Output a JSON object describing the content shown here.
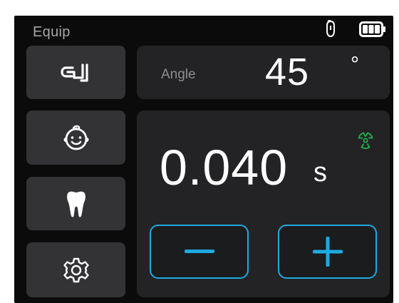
{
  "header": {
    "title": "Equip"
  },
  "status": {
    "probe_icon": "probe-icon",
    "battery_icon": "battery-icon",
    "battery_level": "full"
  },
  "sidebar": {
    "items": [
      {
        "icon": "tube-head-icon"
      },
      {
        "icon": "child-face-icon"
      },
      {
        "icon": "tooth-icon"
      },
      {
        "icon": "gear-icon"
      }
    ]
  },
  "angle": {
    "label": "Angle",
    "value": "45",
    "unit": "°"
  },
  "exposure": {
    "value": "0.040",
    "unit": "s",
    "radiation_icon": "radiation-icon",
    "radiation_color": "#22b24c"
  },
  "controls": {
    "decrease_icon": "minus-icon",
    "increase_icon": "plus-icon",
    "accent_color": "#1fa9e0"
  }
}
